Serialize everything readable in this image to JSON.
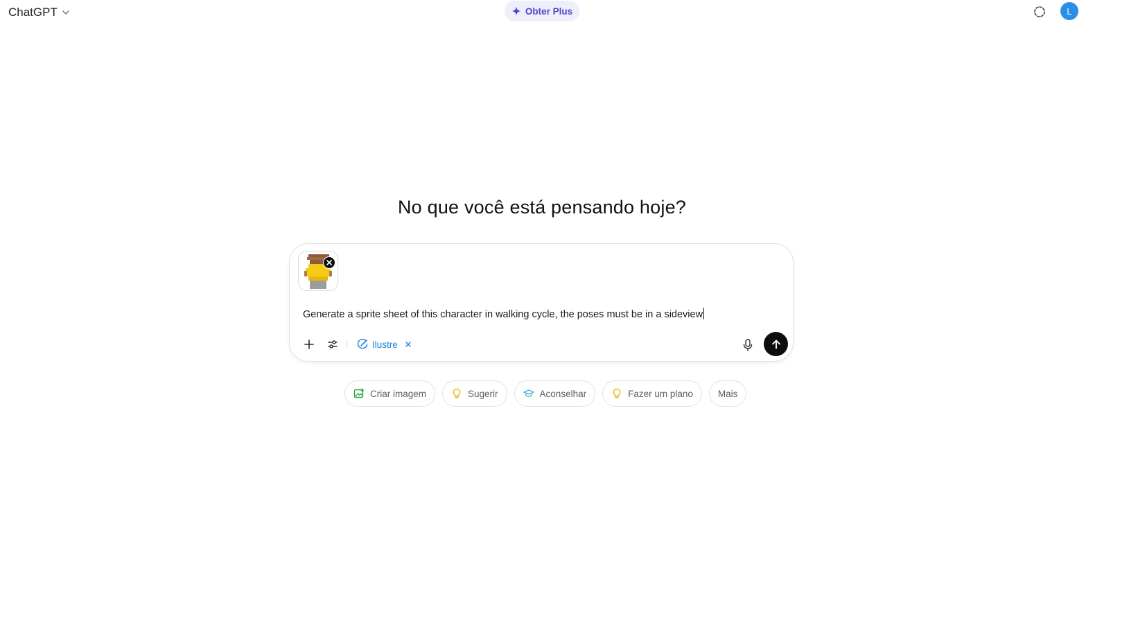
{
  "header": {
    "model_label": "ChatGPT",
    "upgrade_label": "Obter Plus",
    "avatar_letter": "L"
  },
  "main": {
    "headline": "No que você está pensando hoje?"
  },
  "composer": {
    "prompt_text": "Generate a sprite sheet of this character in walking cycle, the poses must be in a sideview",
    "active_tool_label": "Ilustre"
  },
  "suggestions": [
    {
      "label": "Criar imagem",
      "icon": "image-icon",
      "color": "#2ea043"
    },
    {
      "label": "Sugerir",
      "icon": "lightbulb-icon",
      "color": "#e2b719"
    },
    {
      "label": "Aconselhar",
      "icon": "graduation-cap-icon",
      "color": "#3ab1d6"
    },
    {
      "label": "Fazer um plano",
      "icon": "lightbulb-icon",
      "color": "#e2b719"
    },
    {
      "label": "Mais",
      "icon": "",
      "color": ""
    }
  ],
  "colors": {
    "accent_purple": "#5848c4",
    "tool_blue": "#1c7fe0",
    "avatar_blue": "#2b8fe8",
    "send_black": "#0d0d0d"
  }
}
